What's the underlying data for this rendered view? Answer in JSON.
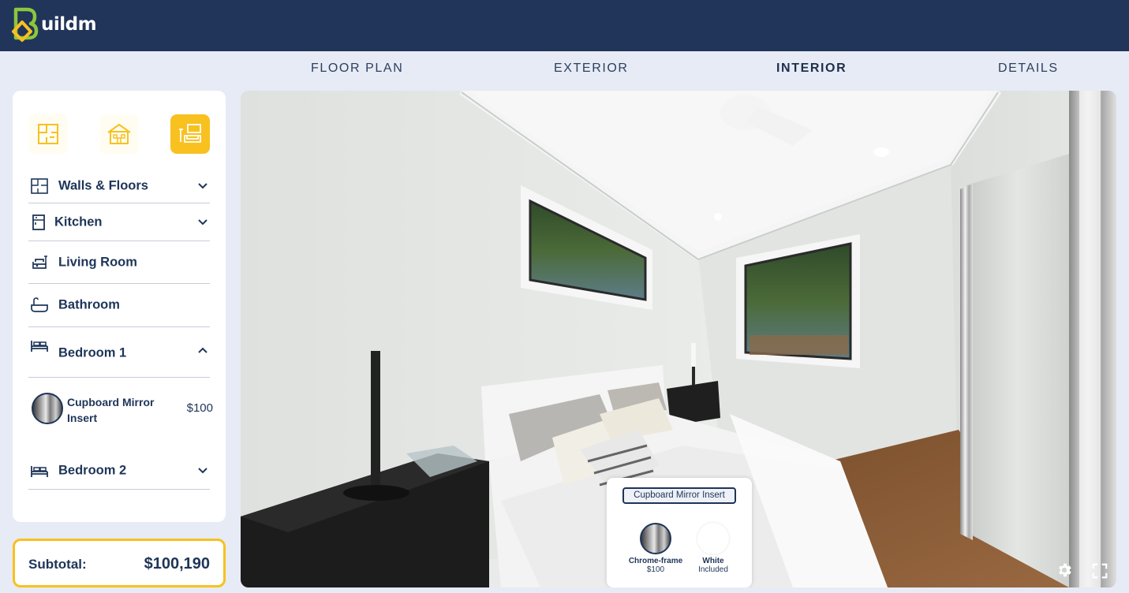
{
  "app": {
    "logo_text": "uildm"
  },
  "tabs": [
    {
      "label": "FLOOR PLAN",
      "active": false
    },
    {
      "label": "EXTERIOR",
      "active": false
    },
    {
      "label": "INTERIOR",
      "active": true
    },
    {
      "label": "DETAILS",
      "active": false
    }
  ],
  "categories": [
    {
      "icon": "floor-plan-icon",
      "active": false
    },
    {
      "icon": "house-exterior-icon",
      "active": false
    },
    {
      "icon": "living-interior-icon",
      "active": true
    }
  ],
  "sections": [
    {
      "label": "Walls & Floors",
      "icon": "walls-floors-icon",
      "expanded": false,
      "has_chevron": true
    },
    {
      "label": "Kitchen",
      "icon": "kitchen-icon",
      "expanded": false,
      "has_chevron": true
    },
    {
      "label": "Living Room",
      "icon": "sofa-icon",
      "expanded": false,
      "has_chevron": false
    },
    {
      "label": "Bathroom",
      "icon": "bathtub-icon",
      "expanded": false,
      "has_chevron": false
    },
    {
      "label": "Bedroom 1",
      "icon": "bed-icon",
      "expanded": true,
      "has_chevron": true
    },
    {
      "label": "Bedroom 2",
      "icon": "bed-icon",
      "expanded": false,
      "has_chevron": true
    }
  ],
  "bedroom1_options": [
    {
      "name": "Cupboard Mirror Insert",
      "price": "$100"
    }
  ],
  "subtotal": {
    "label": "Subtotal:",
    "value": "$100,190"
  },
  "popup": {
    "title": "Cupboard Mirror Insert",
    "options": [
      {
        "name": "Chrome-frame",
        "price": "$100",
        "selected": true
      },
      {
        "name": "White",
        "price": "Included",
        "selected": false
      }
    ]
  },
  "colors": {
    "header": "#203559",
    "accent": "#f8c11f",
    "text": "#1e3558",
    "background": "#e6ebf5"
  }
}
